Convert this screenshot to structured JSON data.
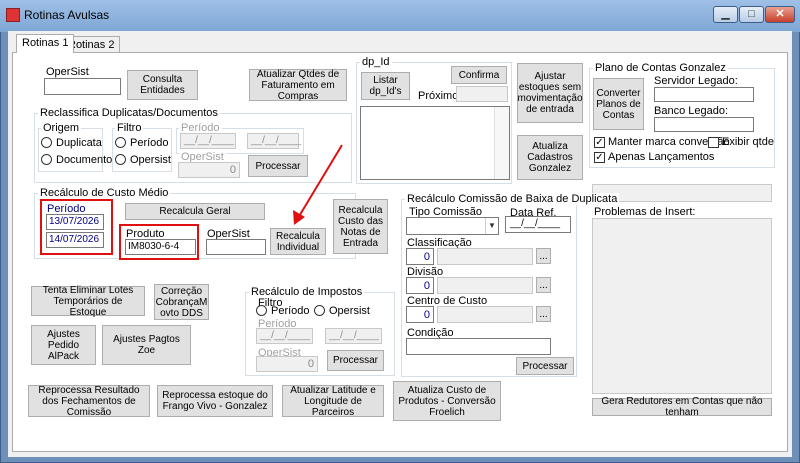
{
  "window": {
    "title": "Rotinas Avulsas"
  },
  "caption": {
    "minimize": "▁",
    "maximize": "□",
    "close": "✕"
  },
  "tabs": [
    {
      "label": "Rotinas 1"
    },
    {
      "label": "Rotinas 2"
    }
  ],
  "opersist_top": {
    "label": "OperSist",
    "value": "",
    "consulta_button": "Consulta Entidades"
  },
  "atualizar_qtdes_button": "Atualizar Qtdes de Faturamento em Compras",
  "reclassifica": {
    "title": "Reclassifica Duplicatas/Documentos",
    "origem_title": "Origem",
    "origem_options": [
      "Duplicata",
      "Documento"
    ],
    "filtro_title": "Filtro",
    "filtro_options": [
      "Período",
      "Opersist"
    ],
    "periodo_label": "Período",
    "date_mask": "__/__/____",
    "opersist_label": "OperSist",
    "opersist_value": "0",
    "processar_button": "Processar"
  },
  "dp_id": {
    "title": "dp_Id",
    "listar_button": "Listar dp_Id's",
    "confirma_button": "Confirma",
    "proximo_label": "Próximo:"
  },
  "ajustar_estoques_button": "Ajustar estoques sem movimentação de entrada",
  "atualiza_cadastros_button": "Atualiza Cadastros Gonzalez",
  "plano_contas": {
    "title": "Plano de Contas Gonzalez",
    "converter_button": "Converter Planos de Contas",
    "servidor_label": "Servidor Legado:",
    "banco_label": "Banco Legado:",
    "manter_marca": {
      "label": "Manter marca conversão",
      "checked": true
    },
    "exibir_qtde": {
      "label": "Exibir qtde",
      "checked": false
    },
    "apenas_lancamentos": {
      "label": "Apenas Lançamentos",
      "checked": true
    },
    "check_mark": "✓",
    "problemas_label": "Problemas de Insert:",
    "gera_redutores_button": "Gera Redutores em Contas que não tenham"
  },
  "recalculo_custo": {
    "title": "Recálculo de Custo Médio",
    "periodo_label": "Período",
    "date_from": "13/07/2026",
    "date_to": "14/07/2026",
    "recalcula_geral_button": "Recalcula Geral",
    "produto_label": "Produto",
    "produto_value": "IM8030-6-4",
    "opersist_label": "OperSist",
    "recalcula_individual_button": "Recalcula Individual",
    "recalcula_notas_button": "Recalcula Custo das Notas de Entrada"
  },
  "comissao": {
    "title": "Recálculo Comissão de Baixa de Duplicata",
    "tipo_label": "Tipo Comissão",
    "data_ref_label": "Data Ref.",
    "data_ref_value": "__/__/____",
    "classificacao_label": "Classificação",
    "classificacao_value": "0",
    "divisao_label": "Divisão",
    "divisao_value": "0",
    "centro_label": "Centro de Custo",
    "centro_value": "0",
    "condicao_label": "Condição",
    "ellipsis": "...",
    "processar_button": "Processar"
  },
  "impostos": {
    "title": "Recálculo de Impostos",
    "filtro_label": "Filtro",
    "options": [
      "Período",
      "Opersist"
    ],
    "periodo_label": "Período",
    "date_mask": "__/__/____",
    "opersist_label": "OperSist",
    "opersist_value": "0",
    "processar_button": "Processar"
  },
  "buttons": {
    "tenta_eliminar": "Tenta Eliminar Lotes Temporários de Estoque",
    "correcao": "Correção CobrançaM ovto DDS",
    "ajustes_pedido": "Ajustes Pedido AlPack",
    "ajustes_pagtos": "Ajustes Pagtos Zoe",
    "reprocessa_resultado": "Reprocessa Resultado dos Fechamentos de Comissão",
    "reprocessa_estoque": "Reprocessa estoque do Frango Vivo - Gonzalez",
    "atualizar_latitude": "Atualizar Latitude e Longitude de Parceiros",
    "atualiza_custo": "Atualiza Custo de Produtos - Conversão Froelich"
  },
  "colors": {
    "highlight_box": "#e01010",
    "arrow": "#e01010"
  }
}
